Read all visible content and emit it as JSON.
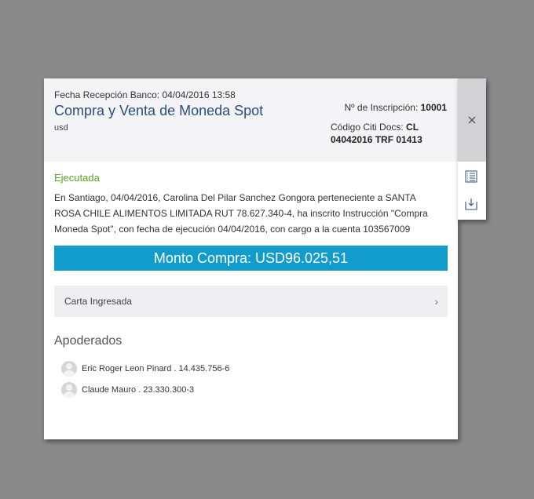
{
  "header": {
    "fecha_label": "Fecha Recepción Banco:",
    "fecha_value": "04/04/2016 13:58",
    "title": "Compra y Venta de Moneda Spot",
    "currency": "usd",
    "inscripcion_label": "Nº de Inscripción:",
    "inscripcion_value": "10001",
    "docs_label": "Código Citi Docs:",
    "docs_value_1": "CL",
    "docs_value_2": "04042016 TRF 01413"
  },
  "status": {
    "label": "Ejecutada",
    "color": "#5aa51e"
  },
  "description": "En Santiago, 04/04/2016, Carolina Del Pilar Sanchez Gongora perteneciente a SANTA ROSA CHILE ALIMENTOS LIMITADA RUT 78.627.340-4, ha inscrito Instrucción \"Compra Moneda Spot\", con fecha de ejecución 04/04/2016, con cargo a la cuenta 103567009",
  "amount": {
    "label": "Monto Compra: USD96.025,51",
    "color": "#129ccc"
  },
  "carta": {
    "label": "Carta Ingresada",
    "chevron": "›"
  },
  "apoderados": {
    "title": "Apoderados",
    "items": [
      {
        "name": "Eric Roger Leon Pinard . 14.435.756-6",
        "icon": "user-avatar-icon"
      },
      {
        "name": "Claude Mauro . 23.330.300-3",
        "icon": "user-avatar-icon"
      }
    ]
  },
  "side_actions": {
    "close_icon": "close-icon",
    "list_icon": "list-icon",
    "download_icon": "download-icon"
  }
}
